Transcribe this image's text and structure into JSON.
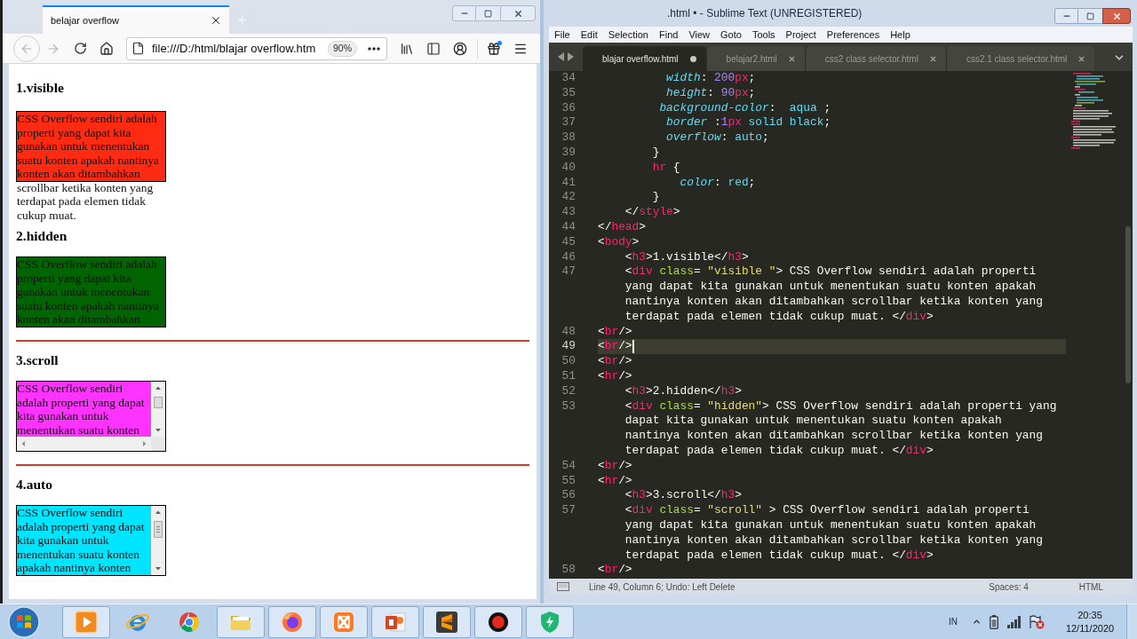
{
  "browser": {
    "tabs": [
      {
        "title": "belajar overflow",
        "selected": true
      }
    ],
    "navigation": {
      "back": {
        "disabled": true
      },
      "forward": {
        "disabled": true
      }
    },
    "address_bar": {
      "url": "file:///D:/html/blajar overflow.htm",
      "zoom": "90%"
    },
    "page": {
      "sections": [
        {
          "heading": "1.visible",
          "kind": "visible",
          "rule_before": false,
          "color": "#ff2a12",
          "text": "CSS Overflow sendiri adalah properti yang dapat kita gunakan untuk menentukan suatu konten apakah nantinya konten akan ditambahkan scrollbar ketika konten yang terdapat pada elemen tidak cukup muat."
        },
        {
          "heading": "2.hidden",
          "kind": "hidden",
          "rule_before": false,
          "color": "#006400",
          "text": "CSS Overflow sendiri adalah properti yang dapat kita gunakan untuk menentukan suatu konten apakah nantinya konten akan ditambahkan"
        },
        {
          "heading": "3.scroll",
          "kind": "scroll",
          "rule_before": true,
          "color": "#ff33ff",
          "text": "CSS Overflow sendiri adalah properti yang dapat kita gunakan untuk menentukan suatu konten"
        },
        {
          "heading": "4.auto",
          "kind": "auto",
          "rule_before": true,
          "color": "#00e5ff",
          "text": "CSS Overflow sendiri adalah properti yang dapat kita gunakan untuk menentukan suatu konten apakah nantinya konten"
        }
      ]
    }
  },
  "editor": {
    "title": ".html • - Sublime Text (UNREGISTERED)",
    "menu": [
      "File",
      "Edit",
      "Selection",
      "Find",
      "View",
      "Goto",
      "Tools",
      "Project",
      "Preferences",
      "Help"
    ],
    "tabs": [
      {
        "label": "blajar overflow.html",
        "selected": true,
        "modified": true
      },
      {
        "label": "belajar2.html",
        "selected": false,
        "modified": false
      },
      {
        "label": "css2 class selector.html",
        "selected": false,
        "modified": false
      },
      {
        "label": "css2.1 class selector.html",
        "selected": false,
        "modified": false
      }
    ],
    "lines": [
      {
        "number": "34",
        "current": false,
        "tokens": [
          {
            "kind": "prop",
            "text": "          width"
          },
          {
            "kind": "text",
            "text": ": "
          },
          {
            "kind": "num",
            "text": "200"
          },
          {
            "kind": "unit",
            "text": "px"
          },
          {
            "kind": "text",
            "text": ";"
          }
        ]
      },
      {
        "number": "35",
        "current": false,
        "tokens": [
          {
            "kind": "prop",
            "text": "          height"
          },
          {
            "kind": "text",
            "text": ": "
          },
          {
            "kind": "num",
            "text": "90"
          },
          {
            "kind": "unit",
            "text": "px"
          },
          {
            "kind": "text",
            "text": ";"
          }
        ]
      },
      {
        "number": "36",
        "current": false,
        "tokens": [
          {
            "kind": "prop",
            "text": "         background-color"
          },
          {
            "kind": "text",
            "text": ":  "
          },
          {
            "kind": "value",
            "text": "aqua"
          },
          {
            "kind": "text",
            "text": " ;"
          }
        ]
      },
      {
        "number": "37",
        "current": false,
        "tokens": [
          {
            "kind": "prop",
            "text": "          border"
          },
          {
            "kind": "text",
            "text": " :"
          },
          {
            "kind": "num",
            "text": "1"
          },
          {
            "kind": "unit",
            "text": "px"
          },
          {
            "kind": "value",
            "text": " solid black"
          },
          {
            "kind": "text",
            "text": ";"
          }
        ]
      },
      {
        "number": "38",
        "current": false,
        "tokens": [
          {
            "kind": "prop",
            "text": "          overflow"
          },
          {
            "kind": "text",
            "text": ": "
          },
          {
            "kind": "value",
            "text": "auto"
          },
          {
            "kind": "text",
            "text": ";"
          }
        ]
      },
      {
        "number": "39",
        "current": false,
        "tokens": [
          {
            "kind": "text",
            "text": "        }"
          }
        ]
      },
      {
        "number": "40",
        "current": false,
        "tokens": [
          {
            "kind": "tag",
            "text": "        hr"
          },
          {
            "kind": "text",
            "text": " {"
          }
        ]
      },
      {
        "number": "41",
        "current": false,
        "tokens": [
          {
            "kind": "prop",
            "text": "            color"
          },
          {
            "kind": "text",
            "text": ": "
          },
          {
            "kind": "value",
            "text": "red"
          },
          {
            "kind": "text",
            "text": ";"
          }
        ]
      },
      {
        "number": "42",
        "current": false,
        "tokens": [
          {
            "kind": "text",
            "text": "        }"
          }
        ]
      },
      {
        "number": "43",
        "current": false,
        "tokens": [
          {
            "kind": "text",
            "text": "    </"
          },
          {
            "kind": "tag",
            "text": "style"
          },
          {
            "kind": "text",
            "text": ">"
          }
        ]
      },
      {
        "number": "44",
        "current": false,
        "tokens": [
          {
            "kind": "text",
            "text": "</"
          },
          {
            "kind": "tag",
            "text": "head"
          },
          {
            "kind": "text",
            "text": ">"
          }
        ]
      },
      {
        "number": "45",
        "current": false,
        "tokens": [
          {
            "kind": "text",
            "text": "<"
          },
          {
            "kind": "tag",
            "text": "body"
          },
          {
            "kind": "text",
            "text": ">"
          }
        ]
      },
      {
        "number": "46",
        "current": false,
        "tokens": [
          {
            "kind": "text",
            "text": "    <"
          },
          {
            "kind": "tag",
            "text": "h3"
          },
          {
            "kind": "text",
            "text": ">1.visible</"
          },
          {
            "kind": "tag",
            "text": "h3"
          },
          {
            "kind": "text",
            "text": ">"
          }
        ]
      },
      {
        "number": "47",
        "current": false,
        "tokens": [
          {
            "kind": "text",
            "text": "    <"
          },
          {
            "kind": "tag",
            "text": "div"
          },
          {
            "kind": "attr",
            "text": " class"
          },
          {
            "kind": "text",
            "text": "= "
          },
          {
            "kind": "string",
            "text": "\"visible \""
          },
          {
            "kind": "text",
            "text": "> CSS Overflow sendiri adalah properti yang dapat kita gunakan untuk menentukan suatu konten apakah nantinya konten akan ditambahkan scrollbar ketika konten yang terdapat pada elemen tidak cukup muat. </"
          },
          {
            "kind": "tag",
            "text": "div"
          },
          {
            "kind": "text",
            "text": ">"
          }
        ]
      },
      {
        "number": "48",
        "current": false,
        "tokens": [
          {
            "kind": "text",
            "text": "<"
          },
          {
            "kind": "tag",
            "text": "br"
          },
          {
            "kind": "text",
            "text": "/>"
          }
        ]
      },
      {
        "number": "49",
        "current": true,
        "tokens": [
          {
            "kind": "text",
            "text": "<"
          },
          {
            "kind": "tag",
            "text": "br"
          },
          {
            "kind": "text",
            "text": "/>"
          }
        ]
      },
      {
        "number": "50",
        "current": false,
        "tokens": [
          {
            "kind": "text",
            "text": "<"
          },
          {
            "kind": "tag",
            "text": "br"
          },
          {
            "kind": "text",
            "text": "/>"
          }
        ]
      },
      {
        "number": "51",
        "current": false,
        "tokens": [
          {
            "kind": "text",
            "text": "<"
          },
          {
            "kind": "tag",
            "text": "hr"
          },
          {
            "kind": "text",
            "text": "/>"
          }
        ]
      },
      {
        "number": "52",
        "current": false,
        "tokens": [
          {
            "kind": "text",
            "text": "    <"
          },
          {
            "kind": "tag",
            "text": "h3"
          },
          {
            "kind": "text",
            "text": ">2.hidden</"
          },
          {
            "kind": "tag",
            "text": "h3"
          },
          {
            "kind": "text",
            "text": ">"
          }
        ]
      },
      {
        "number": "53",
        "current": false,
        "tokens": [
          {
            "kind": "text",
            "text": "    <"
          },
          {
            "kind": "tag",
            "text": "div"
          },
          {
            "kind": "attr",
            "text": " class"
          },
          {
            "kind": "text",
            "text": "= "
          },
          {
            "kind": "string",
            "text": "\"hidden\""
          },
          {
            "kind": "text",
            "text": "> CSS Overflow sendiri adalah properti yang dapat kita gunakan untuk menentukan suatu konten apakah nantinya konten akan ditambahkan scrollbar ketika konten yang terdapat pada elemen tidak cukup muat. </"
          },
          {
            "kind": "tag",
            "text": "div"
          },
          {
            "kind": "text",
            "text": ">"
          }
        ]
      },
      {
        "number": "54",
        "current": false,
        "tokens": [
          {
            "kind": "text",
            "text": "<"
          },
          {
            "kind": "tag",
            "text": "br"
          },
          {
            "kind": "text",
            "text": "/>"
          }
        ]
      },
      {
        "number": "55",
        "current": false,
        "tokens": [
          {
            "kind": "text",
            "text": "<"
          },
          {
            "kind": "tag",
            "text": "hr"
          },
          {
            "kind": "text",
            "text": "/>"
          }
        ]
      },
      {
        "number": "56",
        "current": false,
        "tokens": [
          {
            "kind": "text",
            "text": "    <"
          },
          {
            "kind": "tag",
            "text": "h3"
          },
          {
            "kind": "text",
            "text": ">3.scroll</"
          },
          {
            "kind": "tag",
            "text": "h3"
          },
          {
            "kind": "text",
            "text": ">"
          }
        ]
      },
      {
        "number": "57",
        "current": false,
        "tokens": [
          {
            "kind": "text",
            "text": "    <"
          },
          {
            "kind": "tag",
            "text": "div"
          },
          {
            "kind": "attr",
            "text": " class"
          },
          {
            "kind": "text",
            "text": "= "
          },
          {
            "kind": "string",
            "text": "\"scroll\""
          },
          {
            "kind": "text",
            "text": " > CSS Overflow sendiri adalah properti yang dapat kita gunakan untuk menentukan suatu konten apakah nantinya konten akan ditambahkan scrollbar ketika konten yang terdapat pada elemen tidak cukup muat. </"
          },
          {
            "kind": "tag",
            "text": "div"
          },
          {
            "kind": "text",
            "text": ">"
          }
        ]
      },
      {
        "number": "58",
        "current": false,
        "tokens": [
          {
            "kind": "text",
            "text": "<"
          },
          {
            "kind": "tag",
            "text": "br"
          },
          {
            "kind": "text",
            "text": "/>"
          }
        ]
      }
    ],
    "status_bar": {
      "position": "Line 49, Column 6; Undo: Left Delete",
      "indentation": "Spaces: 4",
      "syntax": "HTML"
    }
  },
  "taskbar": {
    "apps": [
      {
        "kind": "play",
        "running": true
      },
      {
        "kind": "ring-globe",
        "running": false
      },
      {
        "kind": "segmented-circle",
        "running": false
      },
      {
        "kind": "folder",
        "running": true
      },
      {
        "kind": "swirl-circle",
        "running": true
      },
      {
        "kind": "cross-logo",
        "running": true
      },
      {
        "kind": "slide-document",
        "running": true
      },
      {
        "kind": "zigzag-tile",
        "running": true
      },
      {
        "kind": "record",
        "running": true
      },
      {
        "kind": "shield",
        "running": true
      }
    ],
    "tray": {
      "language": "IN",
      "time": "20:35",
      "date": "12/11/2020"
    }
  }
}
